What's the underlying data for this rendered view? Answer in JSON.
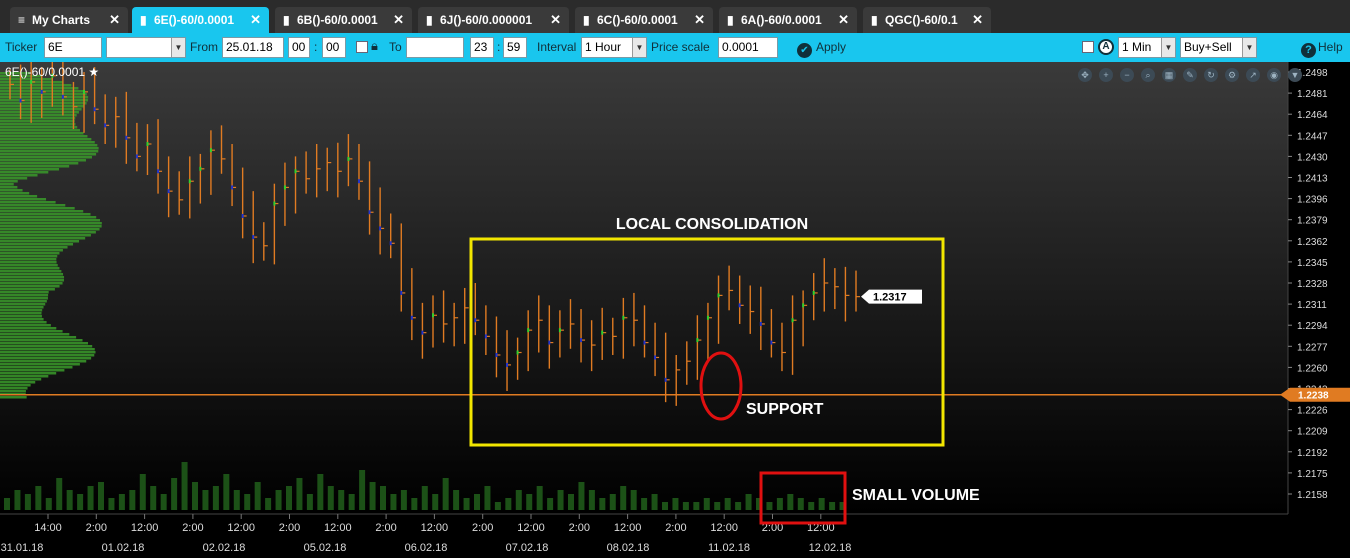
{
  "tabs": [
    {
      "label": "My Charts",
      "icon": "menu-icon",
      "active": false
    },
    {
      "label": "6E()-60/0.0001",
      "icon": "chart-icon",
      "active": true
    },
    {
      "label": "6B()-60/0.0001",
      "icon": "chart-icon",
      "active": false
    },
    {
      "label": "6J()-60/0.000001",
      "icon": "chart-icon",
      "active": false
    },
    {
      "label": "6C()-60/0.0001",
      "icon": "chart-icon",
      "active": false
    },
    {
      "label": "6A()-60/0.0001",
      "icon": "chart-icon",
      "active": false
    },
    {
      "label": "QGC()-60/0.1",
      "icon": "chart-icon",
      "active": false
    }
  ],
  "toolbar": {
    "ticker_label": "Ticker",
    "ticker_value": "6E",
    "ticker_select_value": "",
    "from_label": "From",
    "from_date": "25.01.18",
    "from_hour": "00",
    "from_min": "00",
    "to_label": "To",
    "to_date": "",
    "to_hour": "23",
    "to_min": "59",
    "interval_label": "Interval",
    "interval_value": "1 Hour",
    "price_scale_label": "Price scale",
    "price_scale_value": "0.0001",
    "apply_label": "Apply",
    "timeframe_value": "1 Min",
    "side_value": "Buy+Sell",
    "help_label": "Help"
  },
  "chart_title": "6E()-60/0.0001",
  "colors": {
    "background": "#000000",
    "tab_active": "#19c6ee",
    "bar": "#e07b22",
    "bar_up_accent": "#2fd12f",
    "bar_down_accent": "#2233cc",
    "volume_profile": "#3a9a2a",
    "volume": "#1f5a1a",
    "support_line": "#e07b22",
    "annotation_yellow": "#f2e600",
    "annotation_red": "#e01010"
  },
  "chart_data": {
    "type": "bar",
    "title": "",
    "ylim": [
      1.2145,
      1.2505
    ],
    "y_ticks": [
      "1.2498",
      "1.2481",
      "1.2464",
      "1.2447",
      "1.2430",
      "1.2413",
      "1.2396",
      "1.2379",
      "1.2362",
      "1.2345",
      "1.2328",
      "1.2311",
      "1.2294",
      "1.2277",
      "1.2260",
      "1.2243",
      "1.2226",
      "1.2209",
      "1.2192",
      "1.2175",
      "1.2158"
    ],
    "x_time_ticks": [
      "14:00",
      "2:00",
      "12:00",
      "2:00",
      "12:00",
      "2:00",
      "12:00",
      "2:00",
      "12:00",
      "2:00",
      "12:00",
      "2:00",
      "12:00",
      "2:00",
      "12:00",
      "2:00",
      "12:00"
    ],
    "x_date_ticks": [
      "31.01.18",
      "01.02.18",
      "02.02.18",
      "05.02.18",
      "06.02.18",
      "07.02.18",
      "08.02.18",
      "11.02.18",
      "12.02.18"
    ],
    "last_price": "1.2317",
    "support_price": "1.2238",
    "grid": false,
    "annotations": [
      {
        "text": "LOCAL CONSOLIDATION",
        "type": "rectangle",
        "color": "yellow"
      },
      {
        "text": "SUPPORT",
        "type": "ellipse",
        "color": "red"
      },
      {
        "text": "SMALL VOLUME",
        "type": "rectangle",
        "color": "red"
      }
    ],
    "closes": [
      1.2488,
      1.2475,
      1.249,
      1.2482,
      1.2495,
      1.2478,
      1.247,
      1.2482,
      1.2468,
      1.2455,
      1.2462,
      1.2445,
      1.243,
      1.244,
      1.2418,
      1.2402,
      1.2395,
      1.241,
      1.242,
      1.2435,
      1.2428,
      1.2405,
      1.2382,
      1.2365,
      1.2358,
      1.2392,
      1.2405,
      1.2418,
      1.2412,
      1.242,
      1.2425,
      1.2418,
      1.2428,
      1.241,
      1.2385,
      1.2372,
      1.236,
      1.232,
      1.23,
      1.2288,
      1.2302,
      1.2295,
      1.23,
      1.2308,
      1.2298,
      1.2285,
      1.227,
      1.2262,
      1.2272,
      1.229,
      1.2298,
      1.228,
      1.229,
      1.2295,
      1.2282,
      1.2278,
      1.2288,
      1.2285,
      1.23,
      1.2298,
      1.228,
      1.2268,
      1.225,
      1.2258,
      1.2265,
      1.2282,
      1.23,
      1.2318,
      1.2322,
      1.231,
      1.2305,
      1.2295,
      1.228,
      1.2272,
      1.2298,
      1.231,
      1.232,
      1.2328,
      1.2325,
      1.2318,
      1.2317
    ],
    "volumes": [
      3,
      5,
      4,
      6,
      3,
      8,
      5,
      4,
      6,
      7,
      3,
      4,
      5,
      9,
      6,
      4,
      8,
      12,
      7,
      5,
      6,
      9,
      5,
      4,
      7,
      3,
      5,
      6,
      8,
      4,
      9,
      6,
      5,
      4,
      10,
      7,
      6,
      4,
      5,
      3,
      6,
      4,
      8,
      5,
      3,
      4,
      6,
      2,
      3,
      5,
      4,
      6,
      3,
      5,
      4,
      7,
      5,
      3,
      4,
      6,
      5,
      3,
      4,
      2,
      3,
      2,
      2,
      3,
      2,
      3,
      2,
      4,
      3,
      2,
      3,
      4,
      3,
      2,
      3,
      2,
      2
    ]
  }
}
